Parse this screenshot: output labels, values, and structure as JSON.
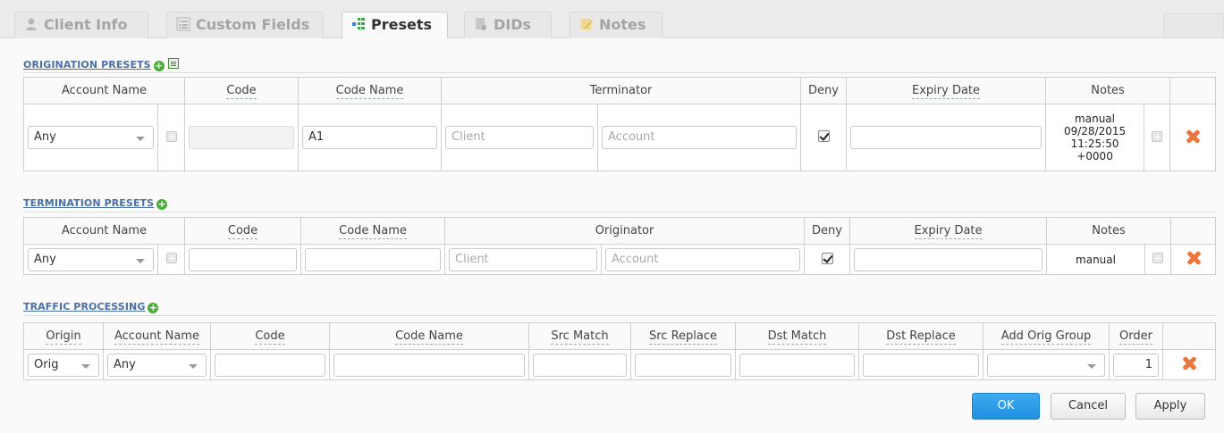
{
  "tabs": [
    {
      "label": "Client Info",
      "icon": "user-icon"
    },
    {
      "label": "Custom Fields",
      "icon": "list-icon"
    },
    {
      "label": "Presets",
      "icon": "presets-icon",
      "active": true
    },
    {
      "label": "DIDs",
      "icon": "dids-icon"
    },
    {
      "label": "Notes",
      "icon": "notes-icon"
    }
  ],
  "origination": {
    "title": "ORIGINATION PRESETS",
    "headers": {
      "account_name": "Account Name",
      "code": "Code",
      "code_name": "Code Name",
      "terminator": "Terminator",
      "deny": "Deny",
      "expiry_date": "Expiry Date",
      "notes": "Notes"
    },
    "row": {
      "account": "Any",
      "code": "",
      "code_name": "A1",
      "client_placeholder": "Client",
      "account_placeholder": "Account",
      "deny": true,
      "expiry_date": "",
      "notes_line1": "manual",
      "notes_line2": "09/28/2015",
      "notes_line3": "11:25:50",
      "notes_line4": "+0000"
    }
  },
  "termination": {
    "title": "TERMINATION PRESETS",
    "headers": {
      "account_name": "Account Name",
      "code": "Code",
      "code_name": "Code Name",
      "originator": "Originator",
      "deny": "Deny",
      "expiry_date": "Expiry Date",
      "notes": "Notes"
    },
    "row": {
      "account": "Any",
      "code": "",
      "code_name": "",
      "client_placeholder": "Client",
      "account_placeholder": "Account",
      "deny": true,
      "expiry_date": "",
      "notes": "manual"
    }
  },
  "traffic": {
    "title": "TRAFFIC PROCESSING",
    "headers": {
      "origin": "Origin",
      "account_name": "Account Name",
      "code": "Code",
      "code_name": "Code Name",
      "src_match": "Src Match",
      "src_replace": "Src Replace",
      "dst_match": "Dst Match",
      "dst_replace": "Dst Replace",
      "add_orig_group": "Add Orig Group",
      "order": "Order"
    },
    "row": {
      "origin": "Orig",
      "account": "Any",
      "code": "",
      "code_name": "",
      "src_match": "",
      "src_replace": "",
      "dst_match": "",
      "dst_replace": "",
      "add_orig_group": "",
      "order": "1"
    }
  },
  "buttons": {
    "ok": "OK",
    "cancel": "Cancel",
    "apply": "Apply"
  }
}
